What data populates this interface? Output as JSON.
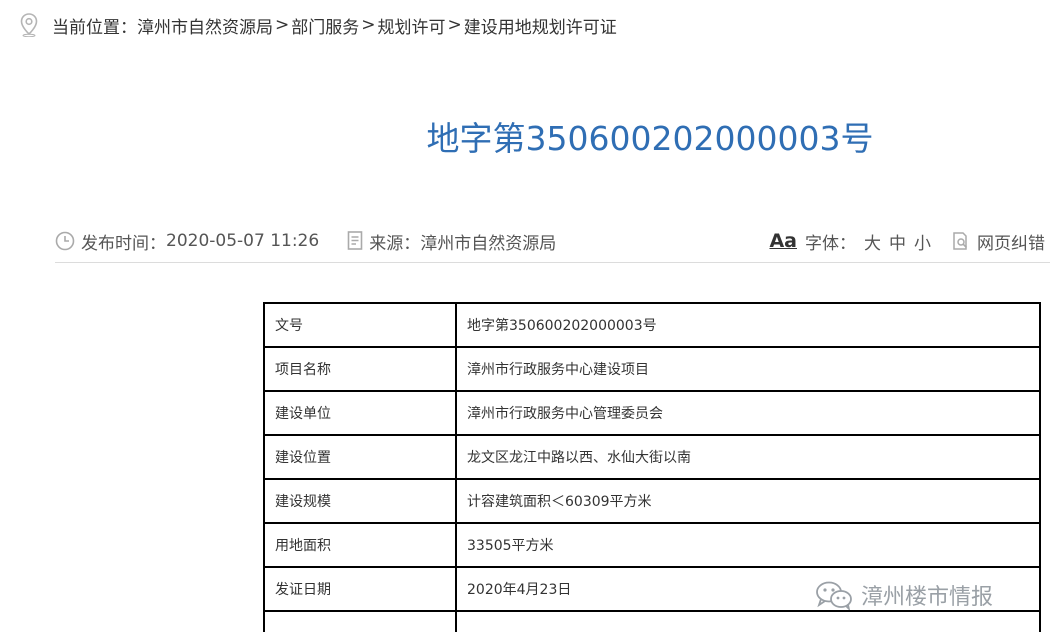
{
  "breadcrumb": {
    "prefix": "当前位置：",
    "items": [
      "漳州市自然资源局",
      "部门服务",
      "规划许可",
      "建设用地规划许可证"
    ],
    "separator": ">"
  },
  "title": "地字第350600202000003号",
  "meta": {
    "publish_label": "发布时间：",
    "publish_time": "2020-05-07 11:26",
    "source_label": "来源：",
    "source": "漳州市自然资源局",
    "font_icon_text": "Aa",
    "font_label": "字体：",
    "font_sizes": [
      "大",
      "中",
      "小"
    ],
    "correction": "网页纠错"
  },
  "table": {
    "rows": [
      {
        "key": "文号",
        "value": "地字第350600202000003号"
      },
      {
        "key": "项目名称",
        "value": "漳州市行政服务中心建设项目"
      },
      {
        "key": "建设单位",
        "value": "漳州市行政服务中心管理委员会"
      },
      {
        "key": "建设位置",
        "value": "龙文区龙江中路以西、水仙大街以南"
      },
      {
        "key": "建设规模",
        "value": "计容建筑面积＜60309平方米"
      },
      {
        "key": "用地面积",
        "value": "33505平方米"
      },
      {
        "key": "发证日期",
        "value": "2020年4月23日"
      }
    ]
  },
  "watermark": "漳州楼市情报",
  "colors": {
    "title": "#2f6eb4",
    "border": "#000000",
    "divider": "#dcdcdc"
  }
}
